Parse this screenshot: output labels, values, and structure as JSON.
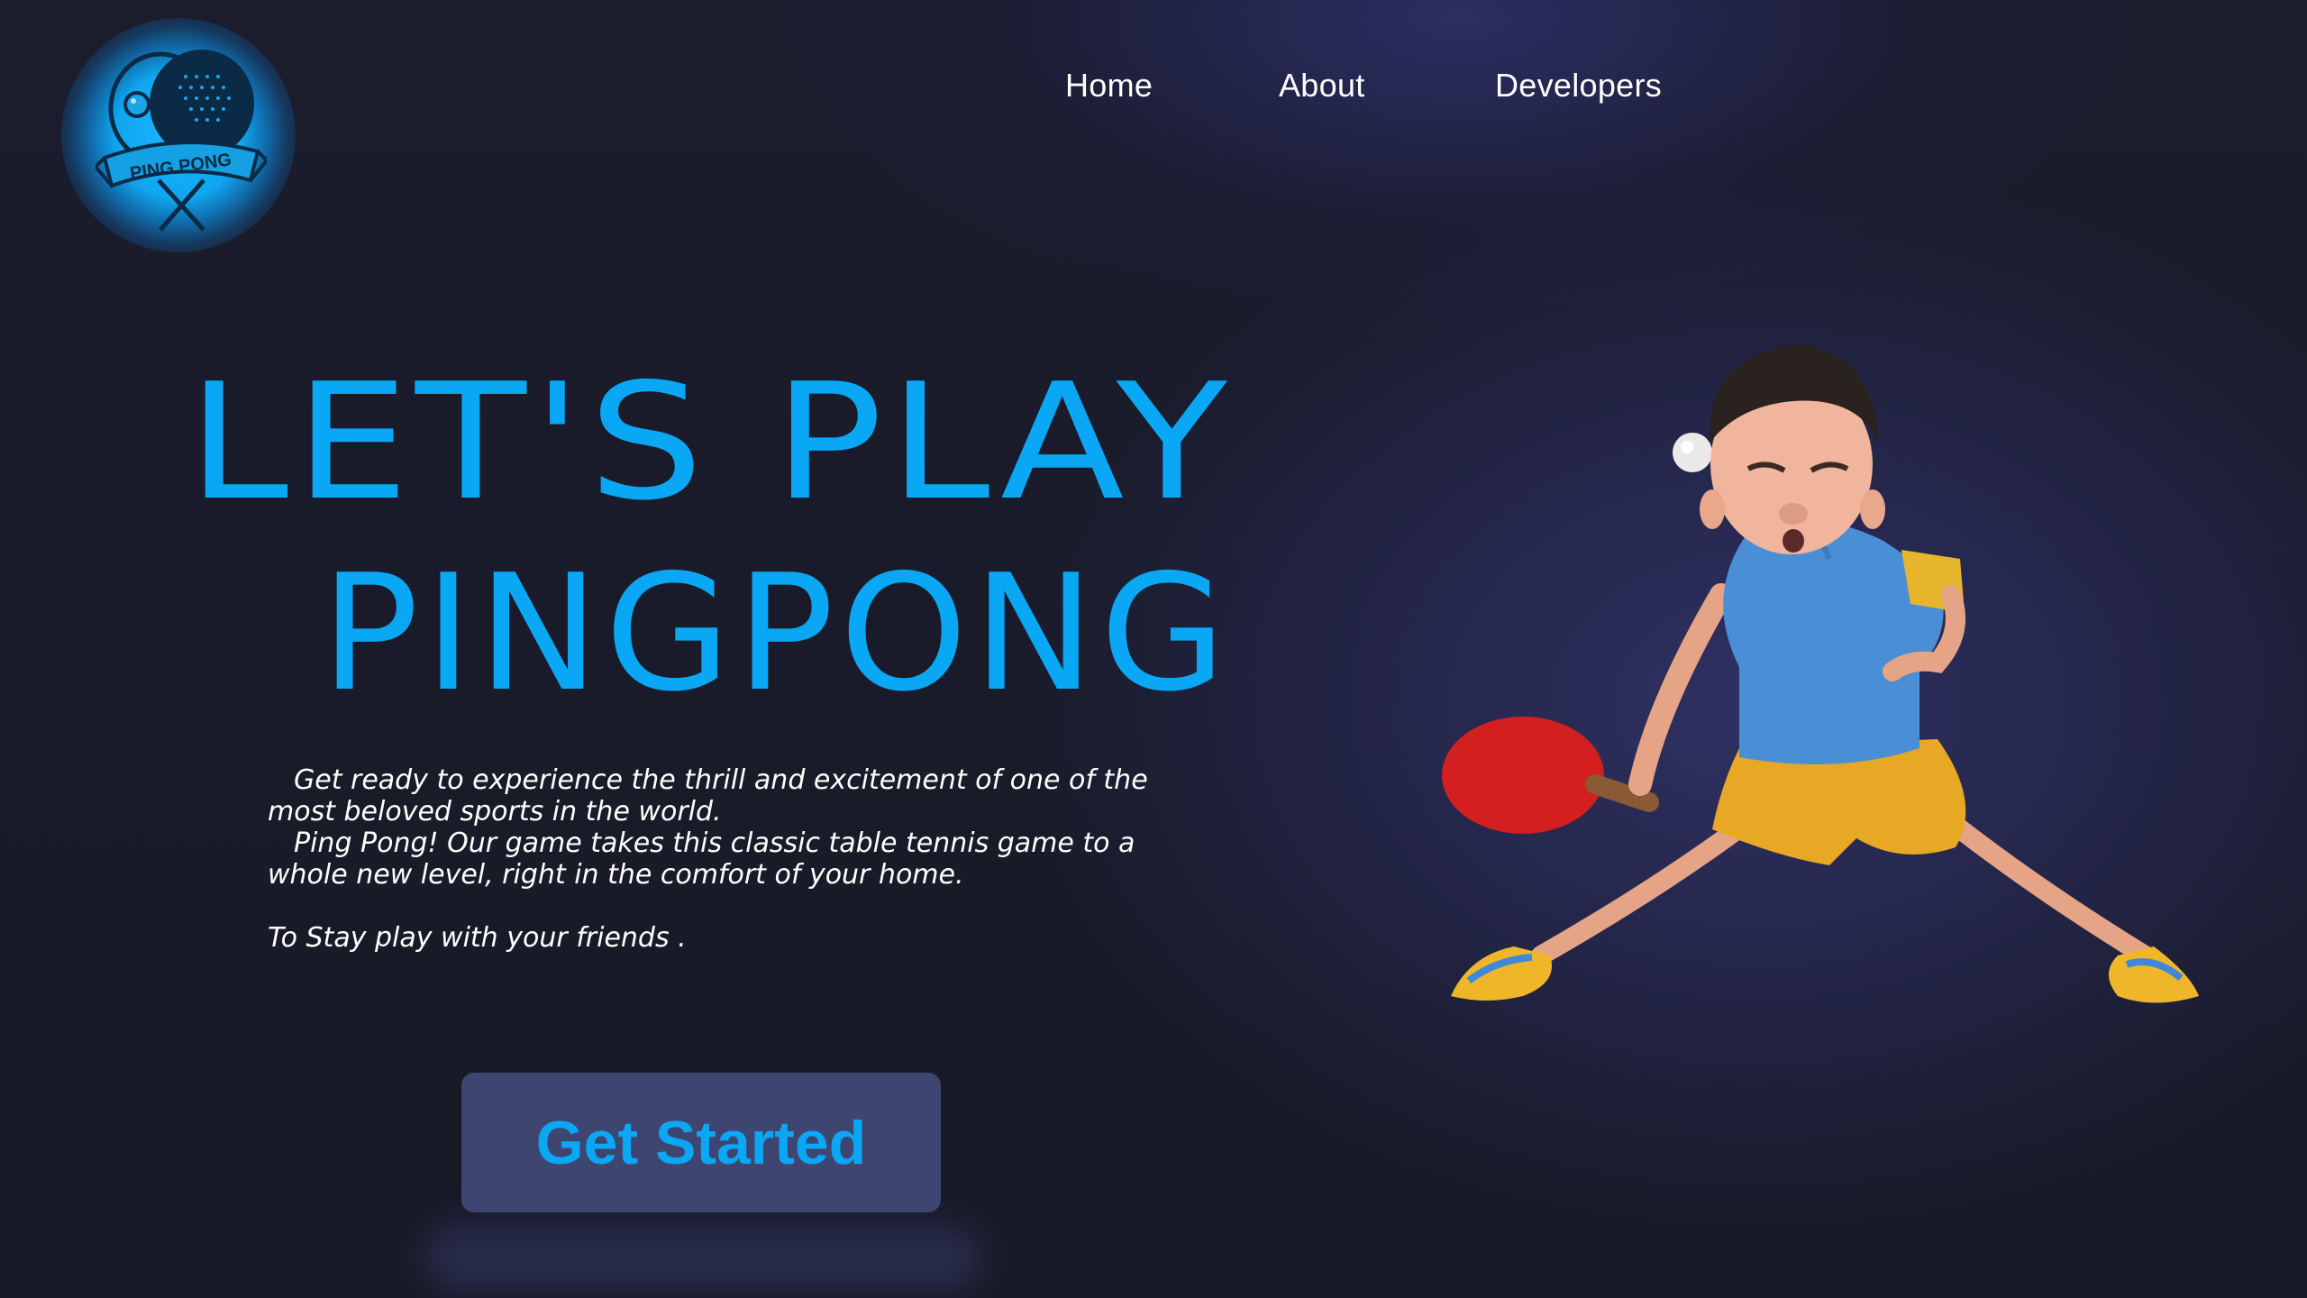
{
  "logo": {
    "text": "PING PONG",
    "icon": "ping-pong-paddles-logo-icon"
  },
  "nav": {
    "items": [
      {
        "label": "Home"
      },
      {
        "label": "About"
      },
      {
        "label": "Developers"
      }
    ]
  },
  "hero": {
    "headline_line1": "LET'S PLAY",
    "headline_line2": "PINGPONG",
    "description": {
      "line1": "Get ready to experience the thrill and excitement of one of the",
      "line2": "most beloved sports in the world.",
      "line3": "Ping Pong! Our game takes this classic table tennis game to a",
      "line4": "whole new level, right in the comfort of your home.",
      "line5": "To Stay play with your friends ."
    },
    "cta_label": "Get Started",
    "illustration_icon": "ping-pong-player-illustration"
  },
  "colors": {
    "accent": "#0aa7f4",
    "background": "#191a29",
    "button_bg": "#3f4571",
    "text": "#ffffff"
  }
}
